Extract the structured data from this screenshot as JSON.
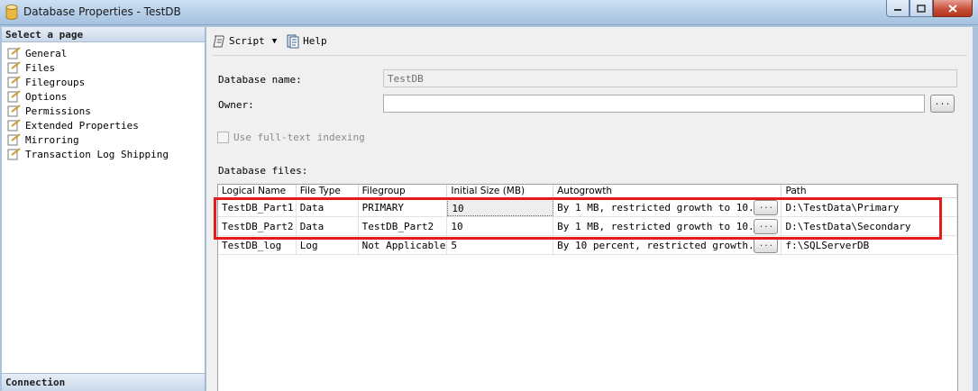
{
  "window": {
    "title": "Database Properties - TestDB"
  },
  "sidebar": {
    "header": "Select a page",
    "items": [
      {
        "label": "General"
      },
      {
        "label": "Files"
      },
      {
        "label": "Filegroups"
      },
      {
        "label": "Options"
      },
      {
        "label": "Permissions"
      },
      {
        "label": "Extended Properties"
      },
      {
        "label": "Mirroring"
      },
      {
        "label": "Transaction Log Shipping"
      }
    ],
    "connection_header": "Connection"
  },
  "toolbar": {
    "script_label": "Script",
    "help_label": "Help"
  },
  "form": {
    "db_name_label": "Database name:",
    "db_name_value": "TestDB",
    "owner_label": "Owner:",
    "owner_value": "",
    "ellipsis": "...",
    "fulltext_label": "Use full-text indexing",
    "db_files_label": "Database files:"
  },
  "grid": {
    "columns": [
      "Logical Name",
      "File Type",
      "Filegroup",
      "Initial Size (MB)",
      "Autogrowth",
      "Path"
    ],
    "rows": [
      {
        "name": "TestDB_Part1",
        "type": "Data",
        "filegroup": "PRIMARY",
        "size": "10",
        "autogrowth": "By 1 MB, restricted growth to 10...",
        "path": "D:\\TestData\\Primary"
      },
      {
        "name": "TestDB_Part2",
        "type": "Data",
        "filegroup": "TestDB_Part2",
        "size": "10",
        "autogrowth": "By 1 MB, restricted growth to 10...",
        "path": "D:\\TestData\\Secondary"
      },
      {
        "name": "TestDB_log",
        "type": "Log",
        "filegroup": "Not Applicable",
        "size": "5",
        "autogrowth": "By 10 percent, restricted growth...",
        "path": "f:\\SQLServerDB"
      }
    ]
  },
  "colors": {
    "highlight": "#e31b1b",
    "titlebar": "#b3cde8"
  }
}
